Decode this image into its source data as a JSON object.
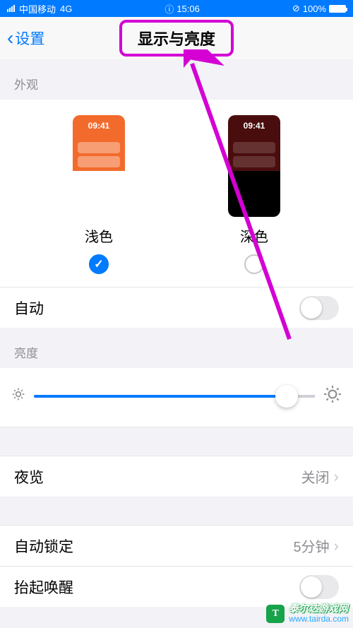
{
  "status": {
    "carrier": "中国移动",
    "network": "4G",
    "time": "15:06",
    "battery_pct": "100%"
  },
  "nav": {
    "back_label": "设置",
    "title": "显示与亮度"
  },
  "sections": {
    "appearance_header": "外观",
    "brightness_header": "亮度"
  },
  "appearance": {
    "light": {
      "label": "浅色",
      "thumb_time": "09:41",
      "selected": true
    },
    "dark": {
      "label": "深色",
      "thumb_time": "09:41",
      "selected": false
    },
    "auto": {
      "label": "自动",
      "on": false
    }
  },
  "brightness": {
    "value_pct": 90
  },
  "rows": {
    "night_shift": {
      "label": "夜览",
      "value": "关闭"
    },
    "auto_lock": {
      "label": "自动锁定",
      "value": "5分钟"
    },
    "raise_wake": {
      "label": "抬起唤醒",
      "on": false
    }
  },
  "watermark": {
    "name": "泰尔达游戏网",
    "url": "www.tairda.com",
    "logo_letter": "T"
  },
  "annotation": {
    "color": "#d400d4"
  }
}
